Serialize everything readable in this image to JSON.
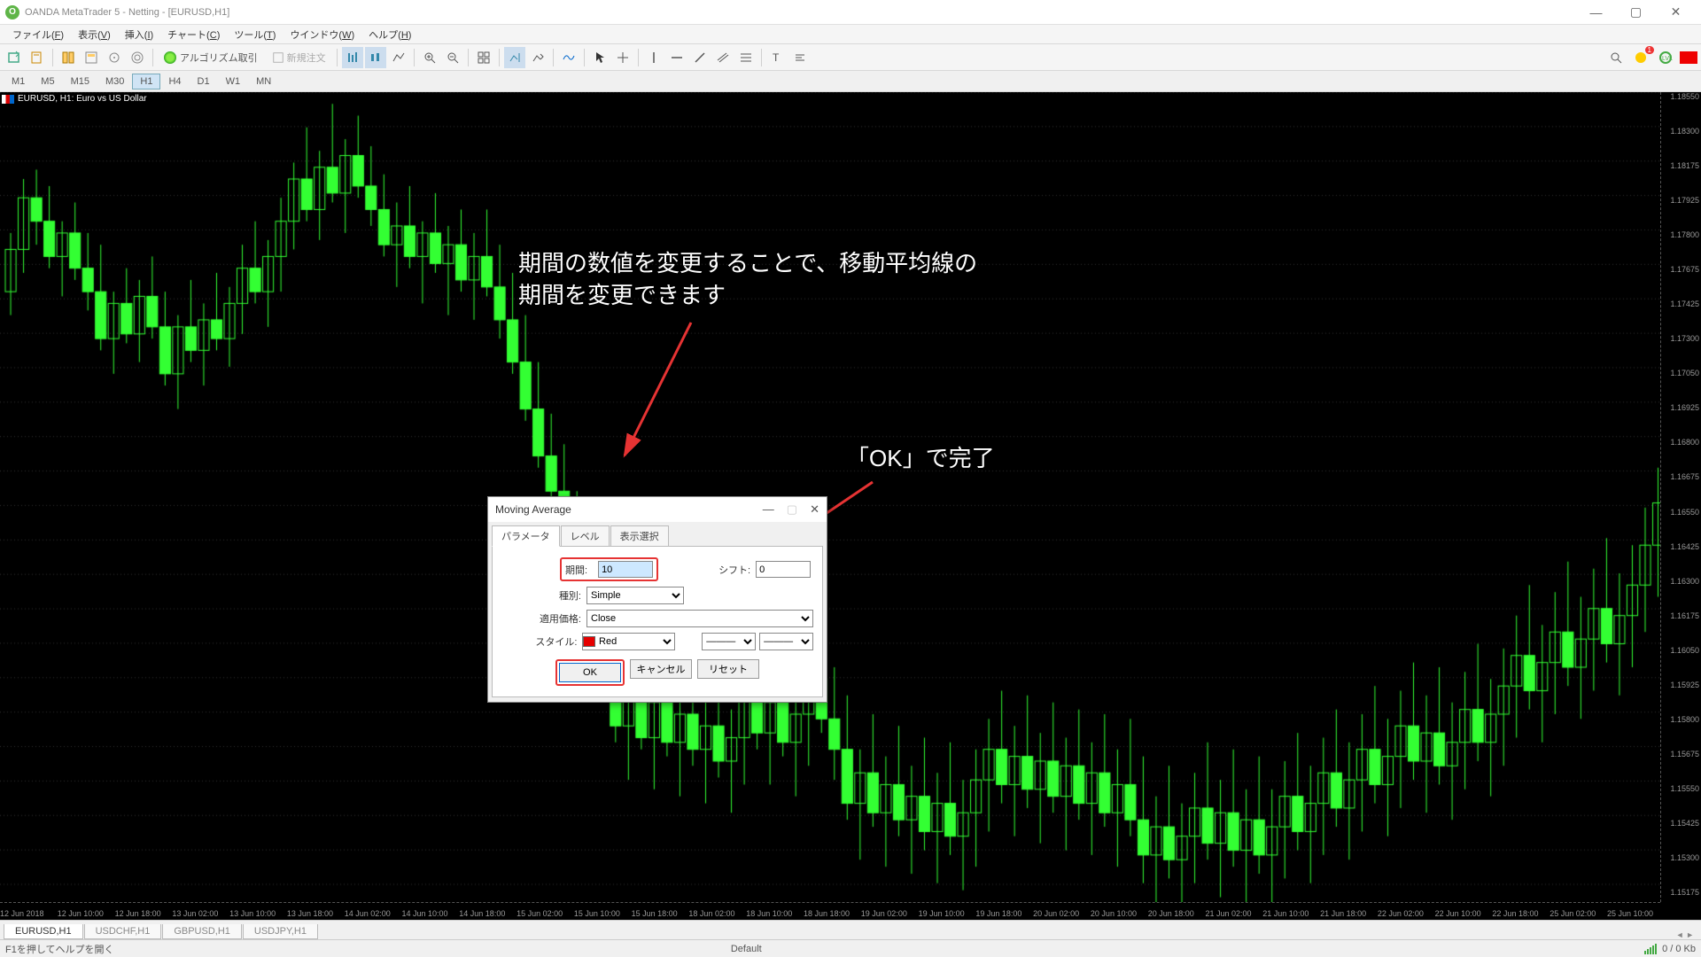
{
  "window": {
    "title": "OANDA MetaTrader 5 - Netting - [EURUSD,H1]"
  },
  "menu": {
    "items": [
      {
        "label": "ファイル",
        "key": "F"
      },
      {
        "label": "表示",
        "key": "V"
      },
      {
        "label": "挿入",
        "key": "I"
      },
      {
        "label": "チャート",
        "key": "C"
      },
      {
        "label": "ツール",
        "key": "T"
      },
      {
        "label": "ウインドウ",
        "key": "W"
      },
      {
        "label": "ヘルプ",
        "key": "H"
      }
    ]
  },
  "toolbar": {
    "algo_label": "アルゴリズム取引",
    "new_order_label": "新規注文",
    "badge1": "1"
  },
  "timeframes": [
    "M1",
    "M5",
    "M15",
    "M30",
    "H1",
    "H4",
    "D1",
    "W1",
    "MN"
  ],
  "timeframe_active": "H1",
  "chart": {
    "symbol_header": "EURUSD, H1: Euro vs US Dollar",
    "price_ticks": [
      "1.18550",
      "1.18300",
      "1.18175",
      "1.17925",
      "1.17800",
      "1.17675",
      "1.17425",
      "1.17300",
      "1.17050",
      "1.16925",
      "1.16800",
      "1.16675",
      "1.16550",
      "1.16425",
      "1.16300",
      "1.16175",
      "1.16050",
      "1.15925",
      "1.15800",
      "1.15675",
      "1.15550",
      "1.15425",
      "1.15300",
      "1.15175"
    ],
    "time_ticks": [
      "12 Jun 2018",
      "12 Jun 10:00",
      "12 Jun 18:00",
      "13 Jun 02:00",
      "13 Jun 10:00",
      "13 Jun 18:00",
      "14 Jun 02:00",
      "14 Jun 10:00",
      "14 Jun 18:00",
      "15 Jun 02:00",
      "15 Jun 10:00",
      "15 Jun 18:00",
      "18 Jun 02:00",
      "18 Jun 10:00",
      "18 Jun 18:00",
      "19 Jun 02:00",
      "19 Jun 10:00",
      "19 Jun 18:00",
      "20 Jun 02:00",
      "20 Jun 10:00",
      "20 Jun 18:00",
      "21 Jun 02:00",
      "21 Jun 10:00",
      "21 Jun 18:00",
      "22 Jun 02:00",
      "22 Jun 10:00",
      "22 Jun 18:00",
      "25 Jun 02:00",
      "25 Jun 10:00"
    ]
  },
  "annotations": {
    "period_text": "期間の数値を変更することで、移動平均線の期間を変更できます",
    "ok_text": "「OK」で完了"
  },
  "dialog": {
    "title": "Moving Average",
    "tabs": [
      "パラメータ",
      "レベル",
      "表示選択"
    ],
    "period_label": "期間:",
    "period_value": "10",
    "shift_label": "シフト:",
    "shift_value": "0",
    "type_label": "種別:",
    "type_value": "Simple",
    "price_label": "適用価格:",
    "price_value": "Close",
    "style_label": "スタイル:",
    "style_value": "Red",
    "btn_ok": "OK",
    "btn_cancel": "キャンセル",
    "btn_reset": "リセット"
  },
  "bottom_tabs": [
    "EURUSD,H1",
    "USDCHF,H1",
    "GBPUSD,H1",
    "USDJPY,H1"
  ],
  "statusbar": {
    "help": "F1を押してヘルプを開く",
    "profile": "Default",
    "conn": "0 / 0 Kb"
  },
  "chart_data": {
    "type": "candlestick",
    "title": "EURUSD, H1: Euro vs US Dollar",
    "xlabel": "",
    "ylabel": "",
    "ylim": [
      1.15175,
      1.1855
    ],
    "candles_note": "approximated OHLC data read from chart grid",
    "ohlc": [
      [
        1.177,
        1.1795,
        1.176,
        1.1788
      ],
      [
        1.1788,
        1.1818,
        1.1778,
        1.181
      ],
      [
        1.181,
        1.1822,
        1.179,
        1.18
      ],
      [
        1.18,
        1.1815,
        1.178,
        1.1785
      ],
      [
        1.1785,
        1.18,
        1.1768,
        1.1795
      ],
      [
        1.1795,
        1.1808,
        1.1775,
        1.178
      ],
      [
        1.178,
        1.1795,
        1.1762,
        1.177
      ],
      [
        1.177,
        1.179,
        1.1745,
        1.175
      ],
      [
        1.175,
        1.177,
        1.1735,
        1.1765
      ],
      [
        1.1765,
        1.178,
        1.1748,
        1.1752
      ],
      [
        1.1752,
        1.1775,
        1.174,
        1.1768
      ],
      [
        1.1768,
        1.1785,
        1.175,
        1.1755
      ],
      [
        1.1755,
        1.177,
        1.173,
        1.1735
      ],
      [
        1.1735,
        1.176,
        1.172,
        1.1755
      ],
      [
        1.1755,
        1.1775,
        1.174,
        1.1745
      ],
      [
        1.1745,
        1.1765,
        1.173,
        1.1758
      ],
      [
        1.1758,
        1.1778,
        1.1745,
        1.175
      ],
      [
        1.175,
        1.1772,
        1.1738,
        1.1765
      ],
      [
        1.1765,
        1.179,
        1.1752,
        1.178
      ],
      [
        1.178,
        1.18,
        1.1765,
        1.177
      ],
      [
        1.177,
        1.1792,
        1.1755,
        1.1785
      ],
      [
        1.1785,
        1.181,
        1.177,
        1.18
      ],
      [
        1.18,
        1.1825,
        1.1788,
        1.1818
      ],
      [
        1.1818,
        1.184,
        1.18,
        1.1805
      ],
      [
        1.1805,
        1.183,
        1.1792,
        1.1823
      ],
      [
        1.1823,
        1.185,
        1.1808,
        1.1812
      ],
      [
        1.1812,
        1.1835,
        1.1795,
        1.1828
      ],
      [
        1.1828,
        1.1845,
        1.181,
        1.1815
      ],
      [
        1.1815,
        1.1832,
        1.1798,
        1.1805
      ],
      [
        1.1805,
        1.182,
        1.1785,
        1.179
      ],
      [
        1.179,
        1.1808,
        1.1772,
        1.1798
      ],
      [
        1.1798,
        1.1815,
        1.178,
        1.1785
      ],
      [
        1.1785,
        1.18,
        1.1765,
        1.1795
      ],
      [
        1.1795,
        1.1812,
        1.1778,
        1.1782
      ],
      [
        1.1782,
        1.1798,
        1.176,
        1.179
      ],
      [
        1.179,
        1.1805,
        1.177,
        1.1775
      ],
      [
        1.1775,
        1.1795,
        1.1758,
        1.1785
      ],
      [
        1.1785,
        1.1805,
        1.1768,
        1.1772
      ],
      [
        1.1772,
        1.179,
        1.175,
        1.1758
      ],
      [
        1.1758,
        1.1778,
        1.1735,
        1.174
      ],
      [
        1.174,
        1.176,
        1.1715,
        1.172
      ],
      [
        1.172,
        1.174,
        1.1695,
        1.17
      ],
      [
        1.17,
        1.1718,
        1.1678,
        1.1685
      ],
      [
        1.1685,
        1.1705,
        1.166,
        1.1665
      ],
      [
        1.1665,
        1.1685,
        1.164,
        1.1645
      ],
      [
        1.1645,
        1.1665,
        1.162,
        1.1625
      ],
      [
        1.1625,
        1.1645,
        1.1598,
        1.1605
      ],
      [
        1.1605,
        1.1625,
        1.1578,
        1.1585
      ],
      [
        1.1585,
        1.161,
        1.1562,
        1.1598
      ],
      [
        1.1598,
        1.162,
        1.1575,
        1.158
      ],
      [
        1.158,
        1.1602,
        1.1558,
        1.1595
      ],
      [
        1.1595,
        1.1615,
        1.1572,
        1.1578
      ],
      [
        1.1578,
        1.16,
        1.1555,
        1.159
      ],
      [
        1.159,
        1.1612,
        1.1568,
        1.1575
      ],
      [
        1.1575,
        1.1598,
        1.1552,
        1.1585
      ],
      [
        1.1585,
        1.1608,
        1.1563,
        1.157
      ],
      [
        1.157,
        1.1592,
        1.1548,
        1.158
      ],
      [
        1.158,
        1.1605,
        1.156,
        1.1598
      ],
      [
        1.1598,
        1.162,
        1.1575,
        1.1582
      ],
      [
        1.1582,
        1.1605,
        1.156,
        1.1595
      ],
      [
        1.1595,
        1.1618,
        1.1572,
        1.1578
      ],
      [
        1.1578,
        1.16,
        1.1555,
        1.159
      ],
      [
        1.159,
        1.1615,
        1.1568,
        1.1605
      ],
      [
        1.1605,
        1.1628,
        1.1582,
        1.1588
      ],
      [
        1.1588,
        1.161,
        1.1562,
        1.1575
      ],
      [
        1.1575,
        1.1598,
        1.1545,
        1.1552
      ],
      [
        1.1552,
        1.1575,
        1.1528,
        1.1565
      ],
      [
        1.1565,
        1.159,
        1.1542,
        1.1548
      ],
      [
        1.1548,
        1.1572,
        1.1525,
        1.156
      ],
      [
        1.156,
        1.1585,
        1.1538,
        1.1545
      ],
      [
        1.1545,
        1.1568,
        1.1522,
        1.1555
      ],
      [
        1.1555,
        1.158,
        1.1532,
        1.154
      ],
      [
        1.154,
        1.1565,
        1.1518,
        1.1552
      ],
      [
        1.1552,
        1.1578,
        1.153,
        1.1538
      ],
      [
        1.1538,
        1.1562,
        1.1515,
        1.1548
      ],
      [
        1.1548,
        1.1575,
        1.1525,
        1.1562
      ],
      [
        1.1562,
        1.1588,
        1.154,
        1.1575
      ],
      [
        1.1575,
        1.16,
        1.1552,
        1.156
      ],
      [
        1.156,
        1.1585,
        1.1538,
        1.1572
      ],
      [
        1.1572,
        1.1598,
        1.155,
        1.1558
      ],
      [
        1.1558,
        1.1582,
        1.1535,
        1.157
      ],
      [
        1.157,
        1.1595,
        1.1548,
        1.1555
      ],
      [
        1.1555,
        1.158,
        1.1532,
        1.1568
      ],
      [
        1.1568,
        1.1592,
        1.1545,
        1.1552
      ],
      [
        1.1552,
        1.1578,
        1.153,
        1.1565
      ],
      [
        1.1565,
        1.159,
        1.1542,
        1.1548
      ],
      [
        1.1548,
        1.1575,
        1.1525,
        1.156
      ],
      [
        1.156,
        1.1588,
        1.1538,
        1.1545
      ],
      [
        1.1545,
        1.1572,
        1.1518,
        1.153
      ],
      [
        1.153,
        1.1555,
        1.1508,
        1.1542
      ],
      [
        1.1542,
        1.1568,
        1.152,
        1.1528
      ],
      [
        1.1528,
        1.1552,
        1.1505,
        1.1538
      ],
      [
        1.1538,
        1.1565,
        1.1518,
        1.155
      ],
      [
        1.155,
        1.1578,
        1.1528,
        1.1535
      ],
      [
        1.1535,
        1.1562,
        1.1512,
        1.1548
      ],
      [
        1.1548,
        1.1575,
        1.1525,
        1.1532
      ],
      [
        1.1532,
        1.1558,
        1.151,
        1.1545
      ],
      [
        1.1545,
        1.1572,
        1.1522,
        1.153
      ],
      [
        1.153,
        1.1558,
        1.1508,
        1.1542
      ],
      [
        1.1542,
        1.157,
        1.152,
        1.1555
      ],
      [
        1.1555,
        1.1582,
        1.1532,
        1.154
      ],
      [
        1.154,
        1.1568,
        1.1518,
        1.1552
      ],
      [
        1.1552,
        1.158,
        1.153,
        1.1565
      ],
      [
        1.1565,
        1.1592,
        1.1542,
        1.155
      ],
      [
        1.155,
        1.1578,
        1.1528,
        1.1562
      ],
      [
        1.1562,
        1.159,
        1.154,
        1.1575
      ],
      [
        1.1575,
        1.1602,
        1.1552,
        1.156
      ],
      [
        1.156,
        1.1588,
        1.1538,
        1.1572
      ],
      [
        1.1572,
        1.16,
        1.155,
        1.1585
      ],
      [
        1.1585,
        1.1612,
        1.1562,
        1.157
      ],
      [
        1.157,
        1.1598,
        1.1548,
        1.1582
      ],
      [
        1.1582,
        1.161,
        1.156,
        1.1568
      ],
      [
        1.1568,
        1.1595,
        1.1545,
        1.1578
      ],
      [
        1.1578,
        1.1608,
        1.1558,
        1.1592
      ],
      [
        1.1592,
        1.162,
        1.157,
        1.1578
      ],
      [
        1.1578,
        1.1605,
        1.1555,
        1.159
      ],
      [
        1.159,
        1.1618,
        1.1568,
        1.1602
      ],
      [
        1.1602,
        1.1632,
        1.158,
        1.1615
      ],
      [
        1.1615,
        1.1645,
        1.1592,
        1.16
      ],
      [
        1.16,
        1.1628,
        1.1578,
        1.1612
      ],
      [
        1.1612,
        1.1642,
        1.159,
        1.1625
      ],
      [
        1.1625,
        1.1655,
        1.1602,
        1.161
      ],
      [
        1.161,
        1.164,
        1.1588,
        1.1622
      ],
      [
        1.1622,
        1.1652,
        1.16,
        1.1635
      ],
      [
        1.1635,
        1.1665,
        1.1612,
        1.162
      ],
      [
        1.162,
        1.165,
        1.1598,
        1.1632
      ],
      [
        1.1632,
        1.1662,
        1.161,
        1.1645
      ],
      [
        1.1645,
        1.1678,
        1.1625,
        1.1662
      ],
      [
        1.1662,
        1.1695,
        1.164,
        1.168
      ]
    ]
  }
}
